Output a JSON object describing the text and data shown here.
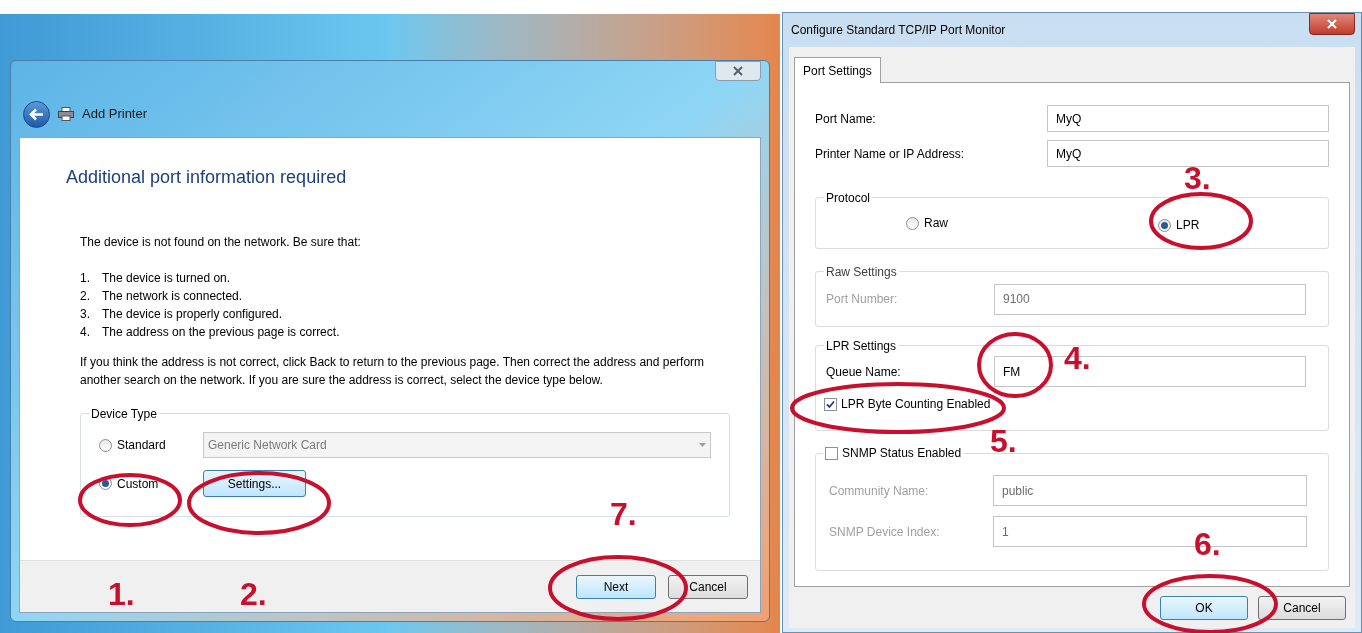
{
  "add_printer": {
    "title": "Add Printer",
    "heading": "Additional port information required",
    "intro": "The device is not found on the network.  Be sure that:",
    "checklist": [
      {
        "number": "1.",
        "text": "The device is turned on."
      },
      {
        "number": "2.",
        "text": "The network is connected."
      },
      {
        "number": "3.",
        "text": "The device is properly configured."
      },
      {
        "number": "4.",
        "text": "The address on the previous page is correct."
      }
    ],
    "advice": "If you think the address is not correct, click Back to return to the previous page.  Then correct the address and perform another search on the network.  If you are sure the address is correct, select the device type below.",
    "device_type": {
      "legend": "Device Type",
      "options": [
        {
          "label": "Standard",
          "selected": false
        },
        {
          "label": "Custom",
          "selected": true
        }
      ],
      "dropdown": "Generic Network Card",
      "settings_button": "Settings..."
    },
    "buttons": [
      {
        "label": "Next",
        "default": true
      },
      {
        "label": "Cancel",
        "default": false
      }
    ]
  },
  "port_monitor": {
    "title": "Configure Standard TCP/IP Port Monitor",
    "tabs": [
      {
        "label": "Port Settings",
        "selected": true
      }
    ],
    "port_name": {
      "label": "Port Name:",
      "value": "MyQ"
    },
    "printer_name": {
      "label": "Printer Name or IP Address:",
      "value": "MyQ"
    },
    "protocol": {
      "legend": "Protocol",
      "options": [
        {
          "label": "Raw",
          "selected": false
        },
        {
          "label": "LPR",
          "selected": true
        }
      ]
    },
    "raw_settings": {
      "legend": "Raw Settings",
      "disabled": true,
      "port_number": {
        "label": "Port Number:",
        "value": "9100"
      }
    },
    "lpr_settings": {
      "legend": "LPR Settings",
      "queue_name": {
        "label": "Queue Name:",
        "value": "FM"
      },
      "byte_counting": {
        "label": "LPR Byte Counting Enabled",
        "checked": true
      }
    },
    "snmp": {
      "label": "SNMP Status Enabled",
      "checked": false,
      "community_name": {
        "label": "Community Name:",
        "value": "public"
      },
      "device_index": {
        "label": "SNMP Device Index:",
        "value": "1"
      }
    },
    "buttons": [
      {
        "label": "OK",
        "default": true
      },
      {
        "label": "Cancel",
        "default": false
      }
    ]
  },
  "annotations": [
    {
      "label": "1."
    },
    {
      "label": "2."
    },
    {
      "label": "3."
    },
    {
      "label": "4."
    },
    {
      "label": "5."
    },
    {
      "label": "6."
    },
    {
      "label": "7."
    }
  ]
}
